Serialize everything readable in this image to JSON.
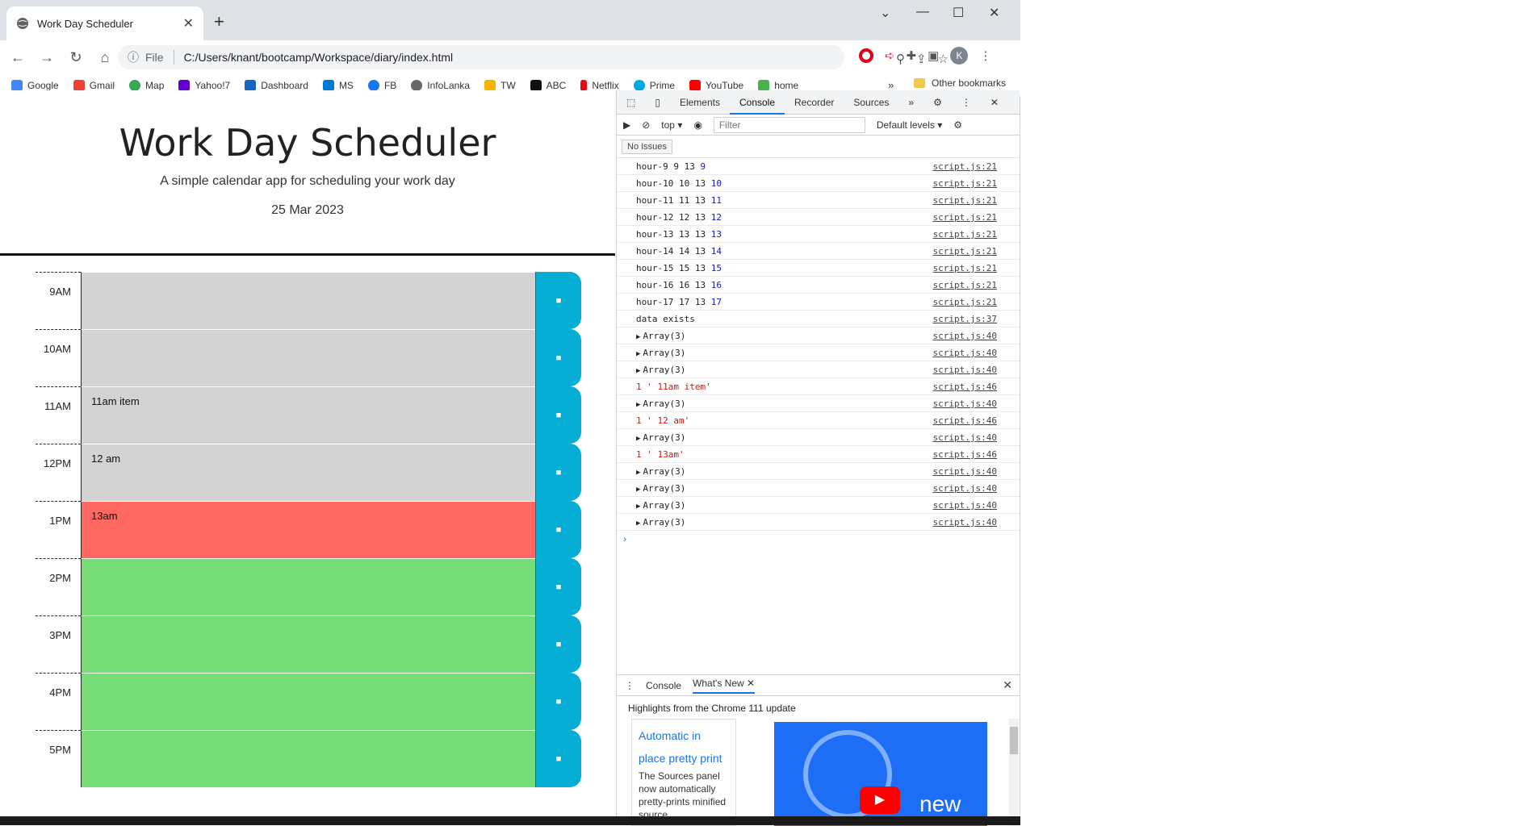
{
  "browser": {
    "tab_title": "Work Day Scheduler",
    "url": "C:/Users/knant/bootcamp/Workspace/diary/index.html",
    "scheme": "File",
    "avatar_initial": "K",
    "bookmarks": [
      "Google",
      "Gmail",
      "Map",
      "Yahoo!7",
      "Dashboard",
      "MS",
      "FB",
      "InfoLanka",
      "TW",
      "ABC",
      "Netflix",
      "Prime",
      "YouTube",
      "home"
    ],
    "other_bookmarks": "Other bookmarks"
  },
  "page": {
    "title": "Work Day Scheduler",
    "subtitle": "A simple calendar app for scheduling your work day",
    "date": "25 Mar 2023",
    "rows": [
      {
        "hour": "9AM",
        "text": "",
        "state": "past"
      },
      {
        "hour": "10AM",
        "text": "",
        "state": "past"
      },
      {
        "hour": "11AM",
        "text": "11am item",
        "state": "past"
      },
      {
        "hour": "12PM",
        "text": "12 am",
        "state": "past"
      },
      {
        "hour": "1PM",
        "text": "13am",
        "state": "present"
      },
      {
        "hour": "2PM",
        "text": "",
        "state": "future"
      },
      {
        "hour": "3PM",
        "text": "",
        "state": "future"
      },
      {
        "hour": "4PM",
        "text": "",
        "state": "future"
      },
      {
        "hour": "5PM",
        "text": "",
        "state": "future"
      }
    ]
  },
  "devtools": {
    "tabs": [
      "Elements",
      "Console",
      "Recorder",
      "Sources"
    ],
    "context": "top",
    "filter_placeholder": "Filter",
    "levels": "Default levels",
    "issues": "No Issues",
    "logs": [
      {
        "text": "hour-9 9 13 ",
        "num": "9",
        "src": "script.js:21",
        "kind": "plain"
      },
      {
        "text": "hour-10 10 13 ",
        "num": "10",
        "src": "script.js:21",
        "kind": "plain"
      },
      {
        "text": "hour-11 11 13 ",
        "num": "11",
        "src": "script.js:21",
        "kind": "plain"
      },
      {
        "text": "hour-12 12 13 ",
        "num": "12",
        "src": "script.js:21",
        "kind": "plain"
      },
      {
        "text": "hour-13 13 13 ",
        "num": "13",
        "src": "script.js:21",
        "kind": "plain"
      },
      {
        "text": "hour-14 14 13 ",
        "num": "14",
        "src": "script.js:21",
        "kind": "plain"
      },
      {
        "text": "hour-15 15 13 ",
        "num": "15",
        "src": "script.js:21",
        "kind": "plain"
      },
      {
        "text": "hour-16 16 13 ",
        "num": "16",
        "src": "script.js:21",
        "kind": "plain"
      },
      {
        "text": "hour-17 17 13 ",
        "num": "17",
        "src": "script.js:21",
        "kind": "plain"
      },
      {
        "text": "data exists",
        "num": "",
        "src": "script.js:37",
        "kind": "plain"
      },
      {
        "text": "Array(3)",
        "num": "",
        "src": "script.js:40",
        "kind": "array"
      },
      {
        "text": "Array(3)",
        "num": "",
        "src": "script.js:40",
        "kind": "array"
      },
      {
        "text": "Array(3)",
        "num": "",
        "src": "script.js:40",
        "kind": "array"
      },
      {
        "text": "1 ' 11am item'",
        "num": "",
        "src": "script.js:46",
        "kind": "str"
      },
      {
        "text": "Array(3)",
        "num": "",
        "src": "script.js:40",
        "kind": "array"
      },
      {
        "text": "1 ' 12 am'",
        "num": "",
        "src": "script.js:46",
        "kind": "str"
      },
      {
        "text": "Array(3)",
        "num": "",
        "src": "script.js:40",
        "kind": "array"
      },
      {
        "text": "1 ' 13am'",
        "num": "",
        "src": "script.js:46",
        "kind": "str"
      },
      {
        "text": "Array(3)",
        "num": "",
        "src": "script.js:40",
        "kind": "array"
      },
      {
        "text": "Array(3)",
        "num": "",
        "src": "script.js:40",
        "kind": "array"
      },
      {
        "text": "Array(3)",
        "num": "",
        "src": "script.js:40",
        "kind": "array"
      },
      {
        "text": "Array(3)",
        "num": "",
        "src": "script.js:40",
        "kind": "array"
      }
    ],
    "drawer": {
      "tabs": [
        "Console",
        "What's New"
      ],
      "highlights": "Highlights from the Chrome 111 update",
      "card_title": "Automatic in place pretty print",
      "card_text": "The Sources panel now automatically pretty-prints minified source",
      "promo_text": "new"
    }
  }
}
